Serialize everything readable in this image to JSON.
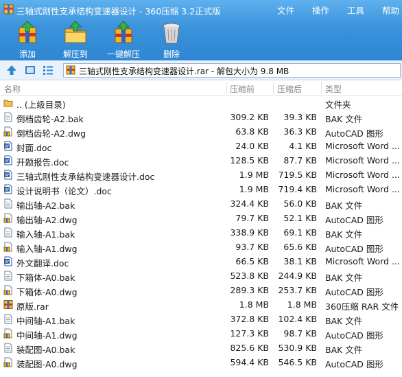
{
  "window": {
    "title": "三轴式刚性支承结构变速器设计 - 360压缩 3.2正式版",
    "menu": [
      "文件",
      "操作",
      "工具",
      "帮助"
    ]
  },
  "toolbar": [
    {
      "label": "添加",
      "icon": "add-archive-icon"
    },
    {
      "label": "解压到",
      "icon": "extract-to-icon"
    },
    {
      "label": "一键解压",
      "icon": "one-click-extract-icon"
    },
    {
      "label": "删除",
      "icon": "delete-trash-icon"
    }
  ],
  "address": {
    "path": "三轴式刚性支承结构变速器设计.rar - 解包大小为 9.8 MB"
  },
  "columns": {
    "name": "名称",
    "size": "压缩前",
    "packed": "压缩后",
    "type": "类型"
  },
  "files": [
    {
      "name": ".. (上级目录)",
      "size": "",
      "packed": "",
      "type": "文件夹",
      "kind": "folder"
    },
    {
      "name": "倒档齿轮-A2.bak",
      "size": "309.2 KB",
      "packed": "39.3 KB",
      "type": "BAK 文件",
      "kind": "bak"
    },
    {
      "name": "倒档齿轮-A2.dwg",
      "size": "63.8 KB",
      "packed": "36.3 KB",
      "type": "AutoCAD 图形",
      "kind": "dwg"
    },
    {
      "name": "封面.doc",
      "size": "24.0 KB",
      "packed": "4.1 KB",
      "type": "Microsoft Word ...",
      "kind": "doc"
    },
    {
      "name": "开题报告.doc",
      "size": "128.5 KB",
      "packed": "87.7 KB",
      "type": "Microsoft Word ...",
      "kind": "doc"
    },
    {
      "name": "三轴式刚性支承结构变速器设计.doc",
      "size": "1.9 MB",
      "packed": "719.5 KB",
      "type": "Microsoft Word ...",
      "kind": "doc"
    },
    {
      "name": "设计说明书（论文）.doc",
      "size": "1.9 MB",
      "packed": "719.4 KB",
      "type": "Microsoft Word ...",
      "kind": "doc"
    },
    {
      "name": "输出轴-A2.bak",
      "size": "324.4 KB",
      "packed": "56.0 KB",
      "type": "BAK 文件",
      "kind": "bak"
    },
    {
      "name": "输出轴-A2.dwg",
      "size": "79.7 KB",
      "packed": "52.1 KB",
      "type": "AutoCAD 图形",
      "kind": "dwg"
    },
    {
      "name": "输入轴-A1.bak",
      "size": "338.9 KB",
      "packed": "69.1 KB",
      "type": "BAK 文件",
      "kind": "bak"
    },
    {
      "name": "输入轴-A1.dwg",
      "size": "93.7 KB",
      "packed": "65.6 KB",
      "type": "AutoCAD 图形",
      "kind": "dwg"
    },
    {
      "name": "外文翻译.doc",
      "size": "66.5 KB",
      "packed": "38.1 KB",
      "type": "Microsoft Word ...",
      "kind": "doc"
    },
    {
      "name": "下箱体-A0.bak",
      "size": "523.8 KB",
      "packed": "244.9 KB",
      "type": "BAK 文件",
      "kind": "bak"
    },
    {
      "name": "下箱体-A0.dwg",
      "size": "289.3 KB",
      "packed": "253.7 KB",
      "type": "AutoCAD 图形",
      "kind": "dwg"
    },
    {
      "name": "原版.rar",
      "size": "1.8 MB",
      "packed": "1.8 MB",
      "type": "360压缩 RAR 文件",
      "kind": "rar"
    },
    {
      "name": "中间轴-A1.bak",
      "size": "372.8 KB",
      "packed": "102.4 KB",
      "type": "BAK 文件",
      "kind": "bak"
    },
    {
      "name": "中间轴-A1.dwg",
      "size": "127.3 KB",
      "packed": "98.7 KB",
      "type": "AutoCAD 图形",
      "kind": "dwg"
    },
    {
      "name": "装配图-A0.bak",
      "size": "825.6 KB",
      "packed": "530.9 KB",
      "type": "BAK 文件",
      "kind": "bak"
    },
    {
      "name": "装配图-A0.dwg",
      "size": "594.4 KB",
      "packed": "546.5 KB",
      "type": "AutoCAD 图形",
      "kind": "dwg"
    }
  ]
}
